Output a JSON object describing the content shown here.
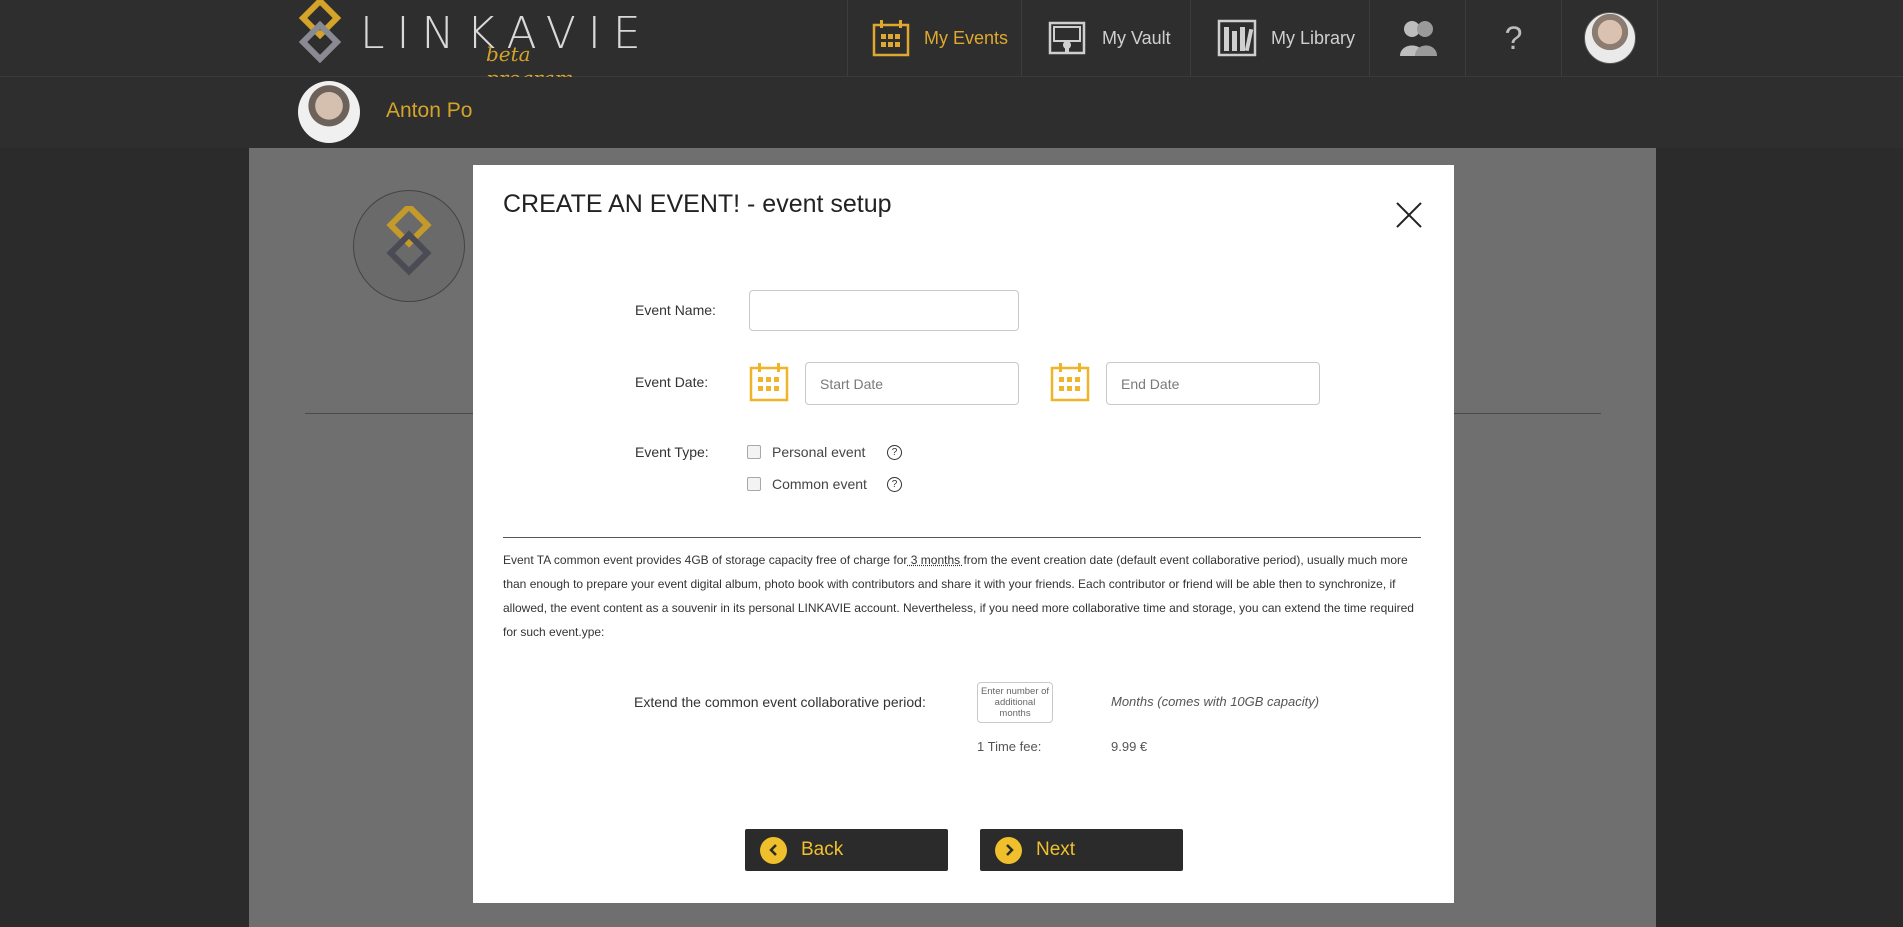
{
  "brand": {
    "name": "LINKAVIE",
    "tagline": "beta program"
  },
  "nav": {
    "events_label": "My Events",
    "vault_label": "My Vault",
    "library_label": "My Library",
    "help_label": "?"
  },
  "user": {
    "name": "Anton Po"
  },
  "modal": {
    "title": "CREATE AN EVENT! - event setup",
    "event_name_label": "Event Name:",
    "event_name_value": "",
    "event_date_label": "Event Date:",
    "start_date_placeholder": "Start Date",
    "end_date_placeholder": "End Date",
    "event_type_label": "Event Type:",
    "personal_event_label": "Personal event",
    "common_event_label": "Common event",
    "help_glyph": "?",
    "description_part1": "Event TA common event provides 4GB of storage capacity  free of charge for",
    "description_link": " 3 months ",
    "description_part2": "from the event creation date (default event collaborative period), usually much more than enough to prepare your event digital album, photo book with contributors and share it with your friends. Each contributor or friend will be able then to synchronize, if allowed, the event content as a souvenir in its personal LINKAVIE account. Nevertheless, if you need more collaborative time and storage, you can extend the time required for such event.ype:",
    "extend_label": "Extend the common event collaborative period:",
    "months_placeholder": "Enter number of additional months",
    "months_note": "Months (comes with 10GB capacity)",
    "fee_label": "1 Time fee:",
    "fee_value": "9.99 €",
    "back_label": "Back",
    "next_label": "Next"
  },
  "colors": {
    "accent": "#d4a32a",
    "button_bg": "#2b2b2b",
    "button_text": "#f0c02c"
  }
}
